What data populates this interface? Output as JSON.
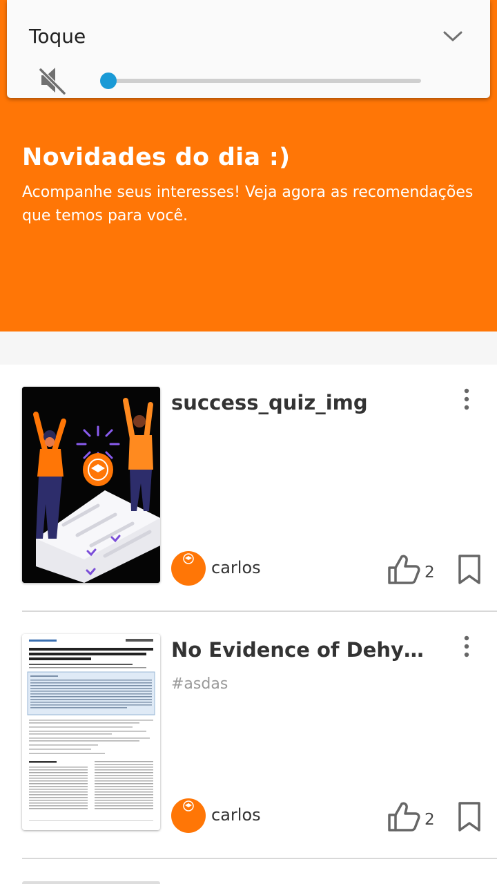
{
  "volume": {
    "title": "Toque",
    "level_percent": 2,
    "muted_icon": "volume-off-icon",
    "expand_icon": "chevron-down-icon",
    "accent": "#1a9ad6"
  },
  "hero": {
    "title": "Novidades do dia :)",
    "subtitle": "Acompanhe seus interesses! Veja agora as recomendações que temos para você.",
    "background": "#ff7606"
  },
  "cards": [
    {
      "title": "success_quiz_img",
      "tag": "",
      "author": "carlos",
      "likes": "2"
    },
    {
      "title": "No Evidence of Dehydration with Moderate Daily Coffee Intake",
      "tag": "#asdas",
      "author": "carlos",
      "likes": "2"
    }
  ]
}
